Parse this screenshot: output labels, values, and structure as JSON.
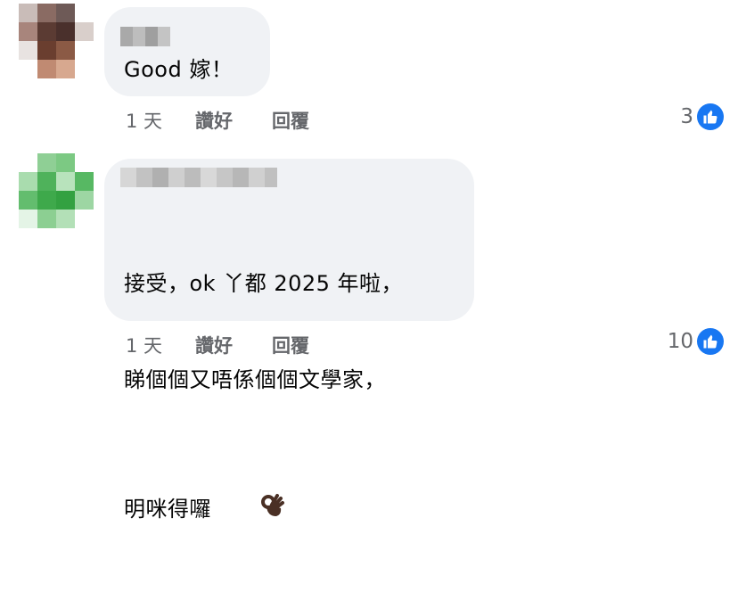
{
  "comments": [
    {
      "text": "Good 嫁！",
      "time": "1 天",
      "like_label": "讚好",
      "reply_label": "回覆",
      "reaction_count": "3"
    },
    {
      "text_line1": "接受，ok 丫都 2025 年啦，",
      "text_line2": "睇個個又唔係個個文學家，",
      "text_line3": "明咪得囉",
      "time": "1 天",
      "like_label": "讚好",
      "reply_label": "回覆",
      "reaction_count": "10"
    }
  ],
  "colors": {
    "bubble": "#f0f2f5",
    "meta_text": "#65676b",
    "like_badge": "#1877f2"
  },
  "icons": [
    "thumbs-up-icon",
    "ok-hand-emoji"
  ]
}
